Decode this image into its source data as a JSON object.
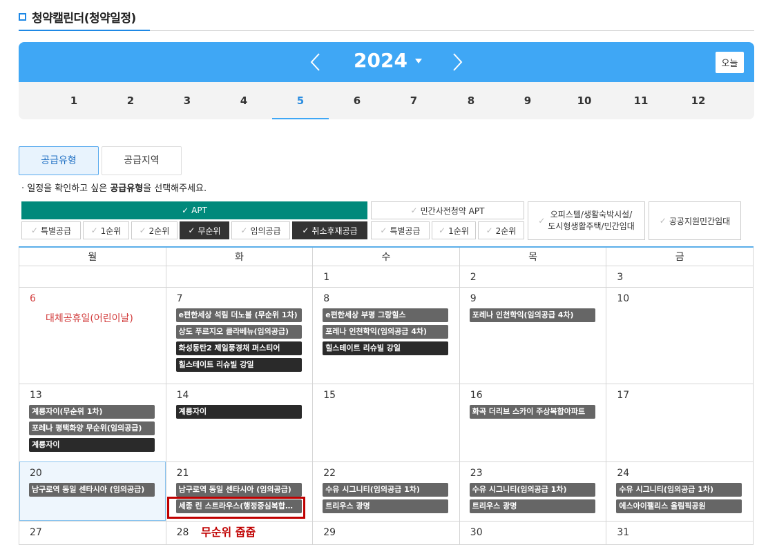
{
  "page": {
    "title": "청약캘린더(청약일정)"
  },
  "header": {
    "year": "2024",
    "today_label": "오늘"
  },
  "months": [
    "1",
    "2",
    "3",
    "4",
    "5",
    "6",
    "7",
    "8",
    "9",
    "10",
    "11",
    "12"
  ],
  "active_month": "5",
  "tabs": {
    "supply_type": "공급유형",
    "supply_region": "공급지역"
  },
  "guide": {
    "prefix": "· 일정을 확인하고 싶은 ",
    "bold": "공급유형",
    "suffix": "을 선택해주세요."
  },
  "filters": {
    "apt": "APT",
    "apt_special": "특별공급",
    "apt_first": "1순위",
    "apt_second": "2순위",
    "apt_unranked": "무순위",
    "apt_arbitrary": "임의공급",
    "apt_cancel": "취소후재공급",
    "presale_apt": "민간사전청약 APT",
    "presale_special": "특별공급",
    "presale_first": "1순위",
    "presale_second": "2순위",
    "officetel_line1": "오피스텔/생활숙박시설/",
    "officetel_line2": "도시형생활주택/민간임대",
    "public_rental": "공공지원민간임대"
  },
  "weekdays": [
    "월",
    "화",
    "수",
    "목",
    "금"
  ],
  "calendar": {
    "w1": [
      "",
      "",
      "1",
      "2",
      "3"
    ],
    "w2": {
      "d6": "6",
      "holiday6": "대체공휴일(어린이날)",
      "d7": "7",
      "e7": [
        "e편한세상 석림 더노블 (무순위 1차)",
        "상도 푸르지오 클라베뉴(임의공급)",
        "화성동탄2 제일풍경채 퍼스티어",
        "힐스테이트 리슈빌 강일"
      ],
      "d8": "8",
      "e8": [
        "e편한세상 부평 그랑힐스",
        "포레나 인천학익(임의공급 4차)",
        "힐스테이트 리슈빌 강일"
      ],
      "d9": "9",
      "e9": [
        "포레나 인천학익(임의공급 4차)"
      ],
      "d10": "10"
    },
    "w3": {
      "d13": "13",
      "e13": [
        "계룡자이(무순위 1차)",
        "포레나 평택화양 무순위(임의공급)",
        "계룡자이"
      ],
      "d14": "14",
      "e14": [
        "계룡자이"
      ],
      "d15": "15",
      "d16": "16",
      "e16": [
        "화곡 더리브 스카이 주상복합아파트"
      ],
      "d17": "17"
    },
    "w4": {
      "d20": "20",
      "e20": [
        "남구로역 동일 센타시아 (임의공급)"
      ],
      "d21": "21",
      "e21": [
        "남구로역 동일 센타시아 (임의공급)",
        "세종 린 스트라우스(행정중심복합도시)"
      ],
      "d22": "22",
      "e22": [
        "수유 시그니티(임의공급 1차)",
        "트리우스 광명"
      ],
      "d23": "23",
      "e23": [
        "수유 시그니티(임의공급 1차)",
        "트리우스 광명"
      ],
      "d24": "24",
      "e24": [
        "수유 시그니티(임의공급 1차)",
        "에스아이팰리스 올림픽공원"
      ]
    },
    "w5": [
      "27",
      "28",
      "29",
      "30",
      "31"
    ]
  },
  "annotation": "무순위 줍줍",
  "colors": {
    "accent": "#3fa7f5",
    "teal": "#00897b",
    "holiday": "#d23c3c",
    "annotation": "#c00000"
  }
}
